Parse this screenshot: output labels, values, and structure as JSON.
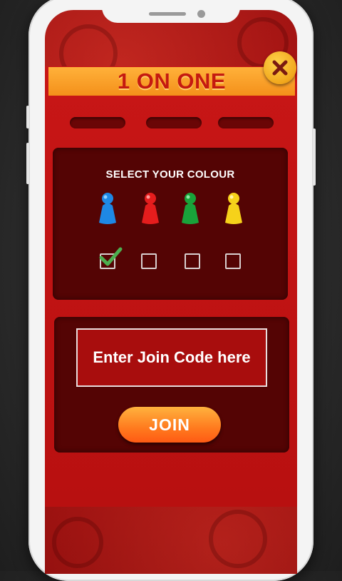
{
  "game_modal": {
    "title": "1 ON ONE",
    "close_icon": "close-x-icon"
  },
  "tabs": [
    {
      "label": ""
    },
    {
      "label": ""
    },
    {
      "label": ""
    }
  ],
  "colour_select": {
    "title": "SELECT YOUR COLOUR",
    "options": [
      {
        "color_name": "blue",
        "color": "#1e88e5",
        "selected": true
      },
      {
        "color_name": "red",
        "color": "#e51d1d",
        "selected": false
      },
      {
        "color_name": "green",
        "color": "#19a33a",
        "selected": false
      },
      {
        "color_name": "yellow",
        "color": "#f6d21a",
        "selected": false
      }
    ]
  },
  "join": {
    "code_placeholder": "Enter Join Code here",
    "code_value": "",
    "button_label": "JOIN"
  },
  "colors": {
    "accent_orange": "#f4901a",
    "title_red": "#c51a10",
    "panel_red": "#c81616",
    "card_dark": "#540404",
    "check_green": "#4caf50"
  }
}
